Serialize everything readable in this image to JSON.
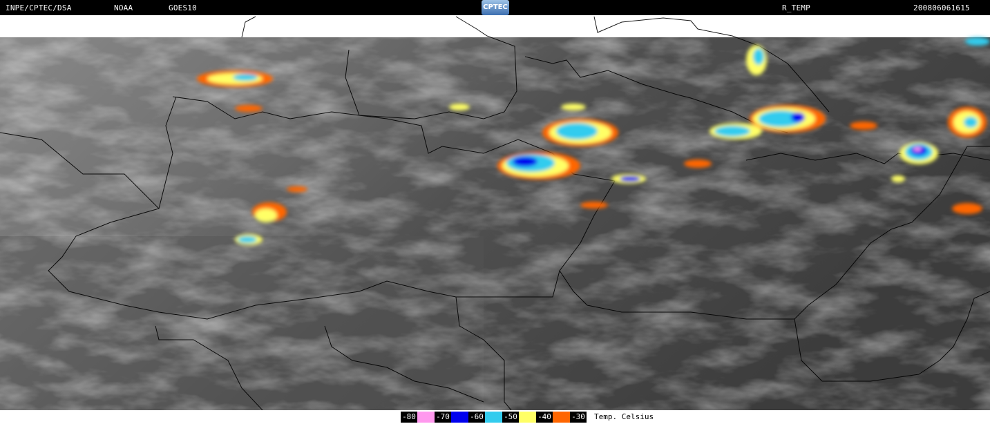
{
  "header": {
    "agency": "INPE/CPTEC/DSA",
    "provider": "NOAA",
    "satellite": "GOES10",
    "logo_text": "CPTEC",
    "product": "R_TEMP",
    "datetime": "200806061615"
  },
  "legend": {
    "entries": [
      {
        "label": "-80",
        "color": "#ff99ee"
      },
      {
        "label": "-70",
        "color": "#0000ee"
      },
      {
        "label": "-60",
        "color": "#33ccee"
      },
      {
        "label": "-50",
        "color": "#ffff66"
      },
      {
        "label": "-40",
        "color": "#ff6600"
      },
      {
        "label": "-30",
        "color": null
      }
    ],
    "unit": "Temp. Celsius"
  }
}
